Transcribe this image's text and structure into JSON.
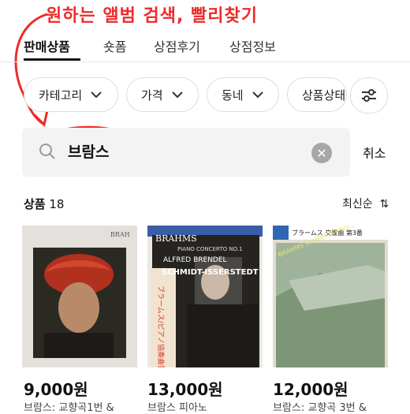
{
  "annotation": {
    "title": "원하는 앨범 검색, 빨리찾기",
    "color": "#ee2a2a"
  },
  "tabs": [
    {
      "label": "판매상품",
      "active": true
    },
    {
      "label": "숏폼",
      "active": false
    },
    {
      "label": "상점후기",
      "active": false
    },
    {
      "label": "상점정보",
      "active": false
    }
  ],
  "filters": {
    "chips": [
      "카테고리",
      "가격",
      "동네",
      "상품상태"
    ],
    "settings_icon": "sliders-icon"
  },
  "search": {
    "value": "브람스",
    "cancel_label": "취소"
  },
  "results": {
    "label": "상품",
    "count": "18",
    "sort_label": "최신순"
  },
  "products": [
    {
      "price": "9,000원",
      "title": "브람스: 교향곡1번 &",
      "cover_text": "BRAH"
    },
    {
      "price": "13,000원",
      "title": "브람스 피아노",
      "cover_text": "BRAHMS",
      "cover_sub": "ALFRED BRENDEL",
      "cover_sub2": "SCHMIDT-ISSERSTEDT",
      "cover_sub3": "PIANO CONCERTO NO.1",
      "cover_jp": "ブラームス/ピアノ協奏曲第一番"
    },
    {
      "price": "12,000원",
      "title": "브람스: 교향곡 3번 &",
      "cover_jp": "ブラームス 交響曲 第3番",
      "cover_text": "BRAHMS SYMPHONY NO.3"
    }
  ]
}
